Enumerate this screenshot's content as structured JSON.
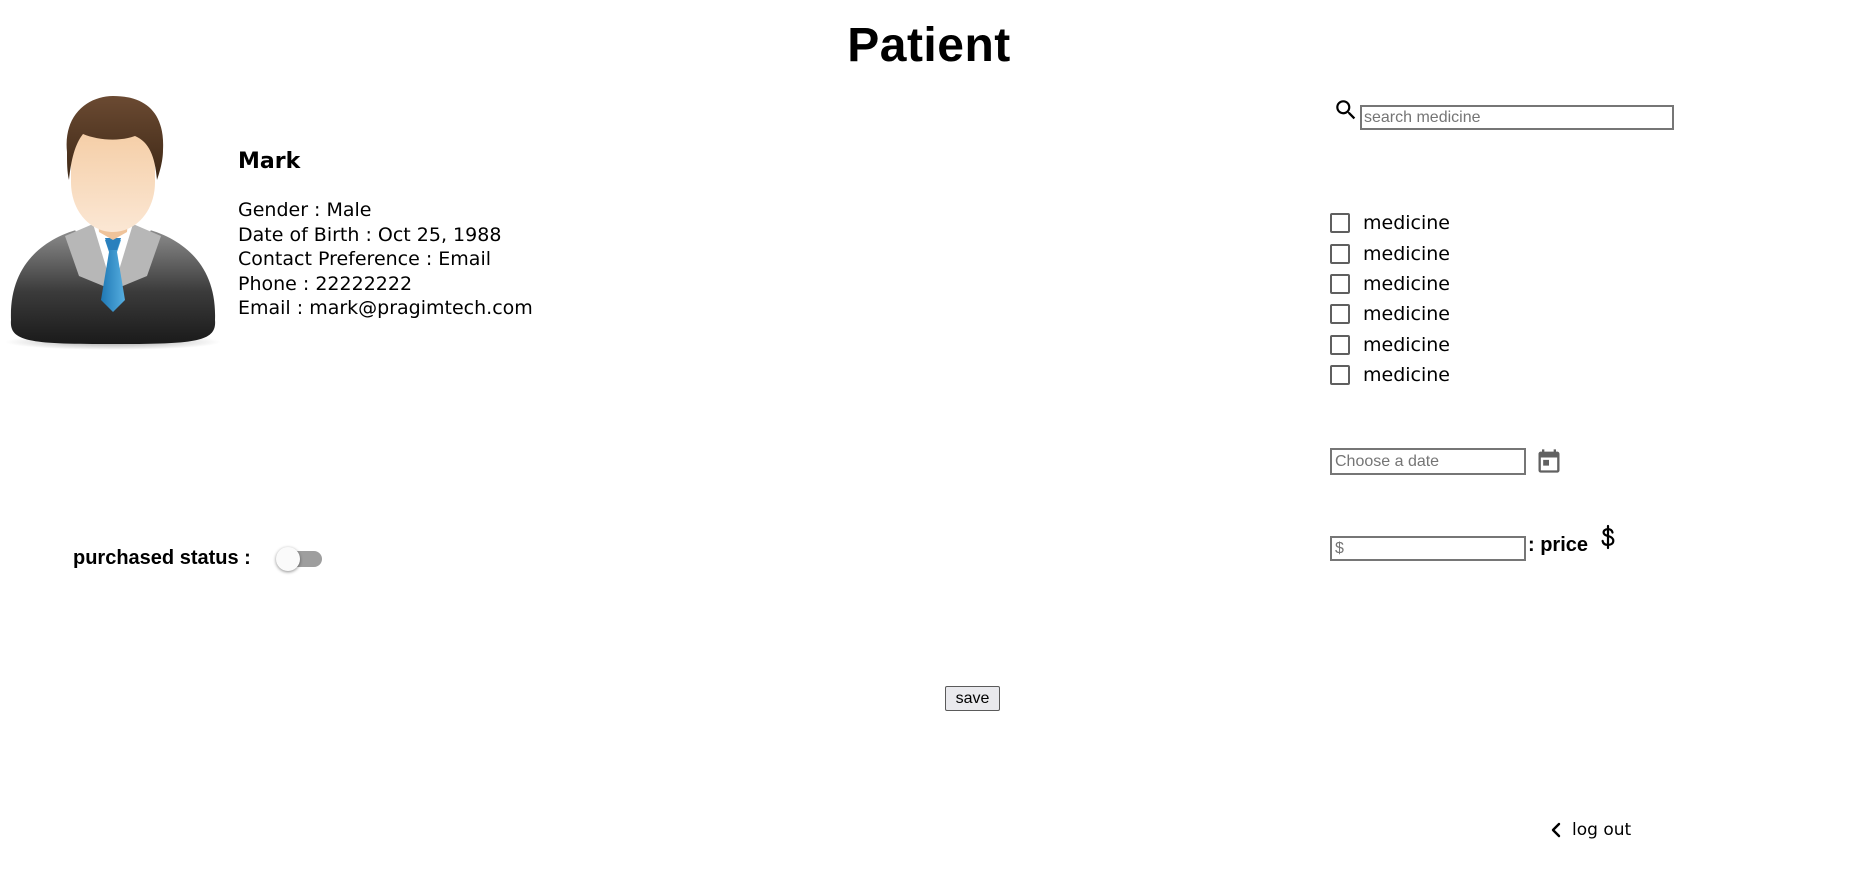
{
  "page": {
    "title": "Patient"
  },
  "patient": {
    "name": "Mark",
    "details": [
      "Gender : Male",
      "Date of Birth : Oct 25, 1988",
      "Contact Preference : Email",
      "Phone : 22222222",
      "Email : mark@pragimtech.com"
    ],
    "avatar_icon": "person-avatar-icon"
  },
  "search": {
    "placeholder": "search medicine",
    "value": "",
    "icon": "search-icon"
  },
  "medicines": [
    {
      "label": "medicine",
      "checked": false
    },
    {
      "label": "medicine",
      "checked": false
    },
    {
      "label": "medicine",
      "checked": false
    },
    {
      "label": "medicine",
      "checked": false
    },
    {
      "label": "medicine",
      "checked": false
    },
    {
      "label": "medicine",
      "checked": false
    }
  ],
  "date": {
    "placeholder": "Choose a date",
    "value": "",
    "icon": "calendar-icon"
  },
  "price": {
    "placeholder": "$",
    "value": "",
    "label": ": price",
    "icon": "dollar-icon"
  },
  "purchased_status": {
    "label": "purchased status :",
    "on": false
  },
  "actions": {
    "save_label": "save",
    "logout_label": "log out"
  },
  "colors": {
    "text": "#000000",
    "input_border": "#767676",
    "checkbox_border": "#5f5f5f",
    "toggle_track": "#9e9e9e",
    "toggle_thumb": "#fafafa",
    "button_bg": "#e9e9ed",
    "icon_gray": "#616161"
  }
}
